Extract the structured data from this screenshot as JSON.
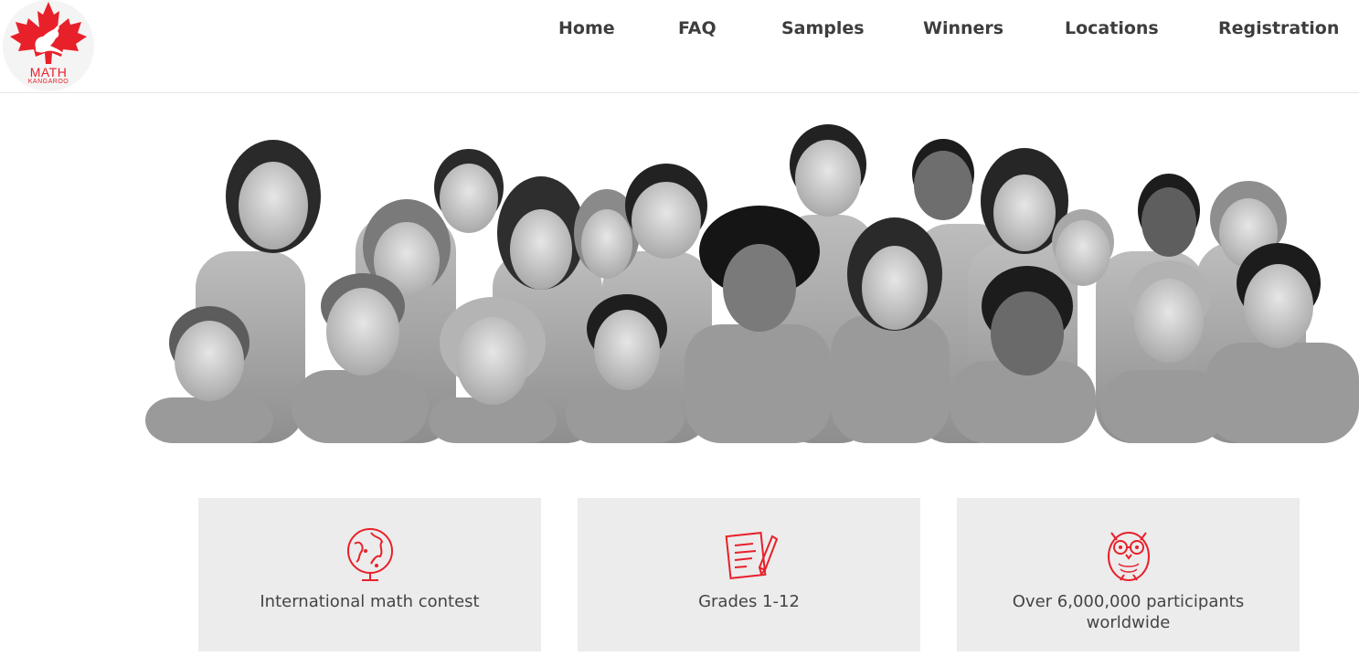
{
  "logo": {
    "main_text": "MATH",
    "sub_text": "KANGAROO",
    "accent_color": "#e8202a"
  },
  "nav": {
    "items": [
      {
        "label": "Home"
      },
      {
        "label": "FAQ"
      },
      {
        "label": "Samples"
      },
      {
        "label": "Winners"
      },
      {
        "label": "Locations"
      },
      {
        "label": "Registration"
      }
    ]
  },
  "hero": {
    "image": "grayscale-group-photo-of-children"
  },
  "features": [
    {
      "icon": "globe-icon",
      "label": "International math contest"
    },
    {
      "icon": "test-paper-pencil-icon",
      "label": "Grades 1-12"
    },
    {
      "icon": "owl-with-glasses-icon",
      "label": "Over 6,000,000 participants worldwide"
    }
  ],
  "colors": {
    "accent": "#e8202a",
    "card_bg": "#ececec",
    "nav_text": "#3d3d3d"
  }
}
